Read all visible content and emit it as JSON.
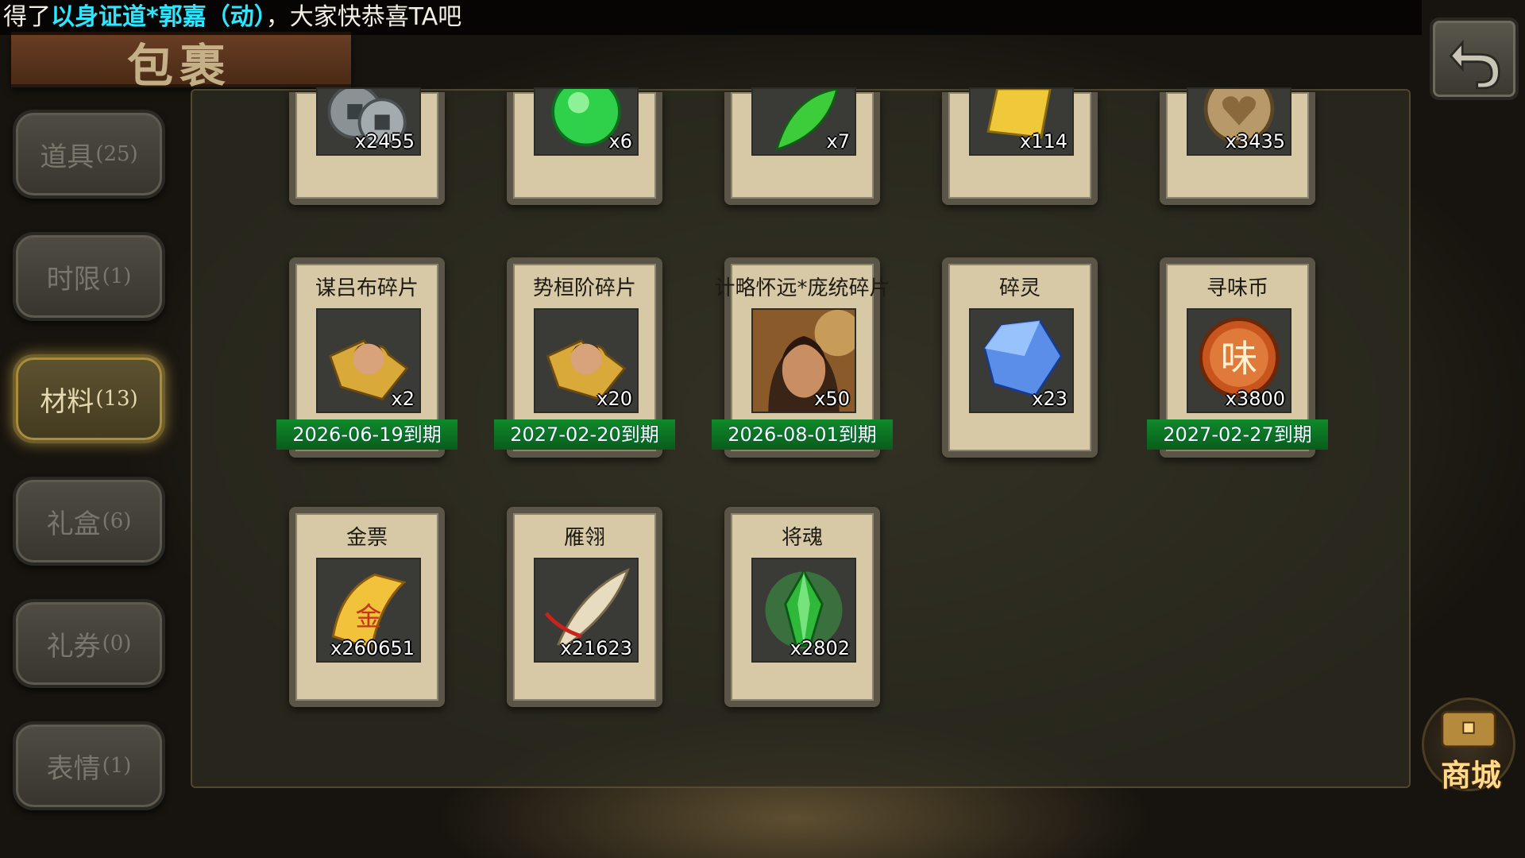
{
  "announcement": {
    "prefix": "得了",
    "highlight": "以身证道*郭嘉（动）",
    "suffix": "，大家快恭喜TA吧"
  },
  "title": "包裹",
  "sidebar": {
    "tabs": [
      {
        "label": "道具",
        "count": "(25)",
        "active": false
      },
      {
        "label": "时限",
        "count": "(1)",
        "active": false
      },
      {
        "label": "材料",
        "count": "(13)",
        "active": true
      },
      {
        "label": "礼盒",
        "count": "(6)",
        "active": false
      },
      {
        "label": "礼券",
        "count": "(0)",
        "active": false
      },
      {
        "label": "表情",
        "count": "(1)",
        "active": false
      }
    ]
  },
  "items": {
    "row1": [
      {
        "icon": "coins-icon",
        "qty": "x2455"
      },
      {
        "icon": "green-orb-icon",
        "qty": "x6"
      },
      {
        "icon": "green-leaf-icon",
        "qty": "x7"
      },
      {
        "icon": "gold-ticket-icon",
        "qty": "x114"
      },
      {
        "icon": "heart-coin-icon",
        "qty": "x3435"
      }
    ],
    "row2": [
      {
        "name": "谋吕布碎片",
        "icon": "hero-puzzle-icon",
        "qty": "x2",
        "expiry": "2026-06-19到期"
      },
      {
        "name": "势桓阶碎片",
        "icon": "hero-puzzle-icon",
        "qty": "x20",
        "expiry": "2027-02-20到期"
      },
      {
        "name": "计略怀远*庞统碎片",
        "icon": "hero-portrait-icon",
        "qty": "x50",
        "expiry": "2026-08-01到期"
      },
      {
        "name": "碎灵",
        "icon": "blue-crystal-icon",
        "qty": "x23",
        "expiry": ""
      },
      {
        "name": "寻味币",
        "icon": "flavor-coin-icon",
        "qty": "x3800",
        "expiry": "2027-02-27到期"
      }
    ],
    "row3": [
      {
        "name": "金票",
        "icon": "gold-scroll-icon",
        "qty": "x260651"
      },
      {
        "name": "雁翎",
        "icon": "feather-icon",
        "qty": "x21623"
      },
      {
        "name": "将魂",
        "icon": "green-soul-crystal-icon",
        "qty": "x2802"
      }
    ],
    "flavor_coin_glyph": "味",
    "gold_scroll_glyph": "金"
  },
  "shop": {
    "label": "商城"
  }
}
